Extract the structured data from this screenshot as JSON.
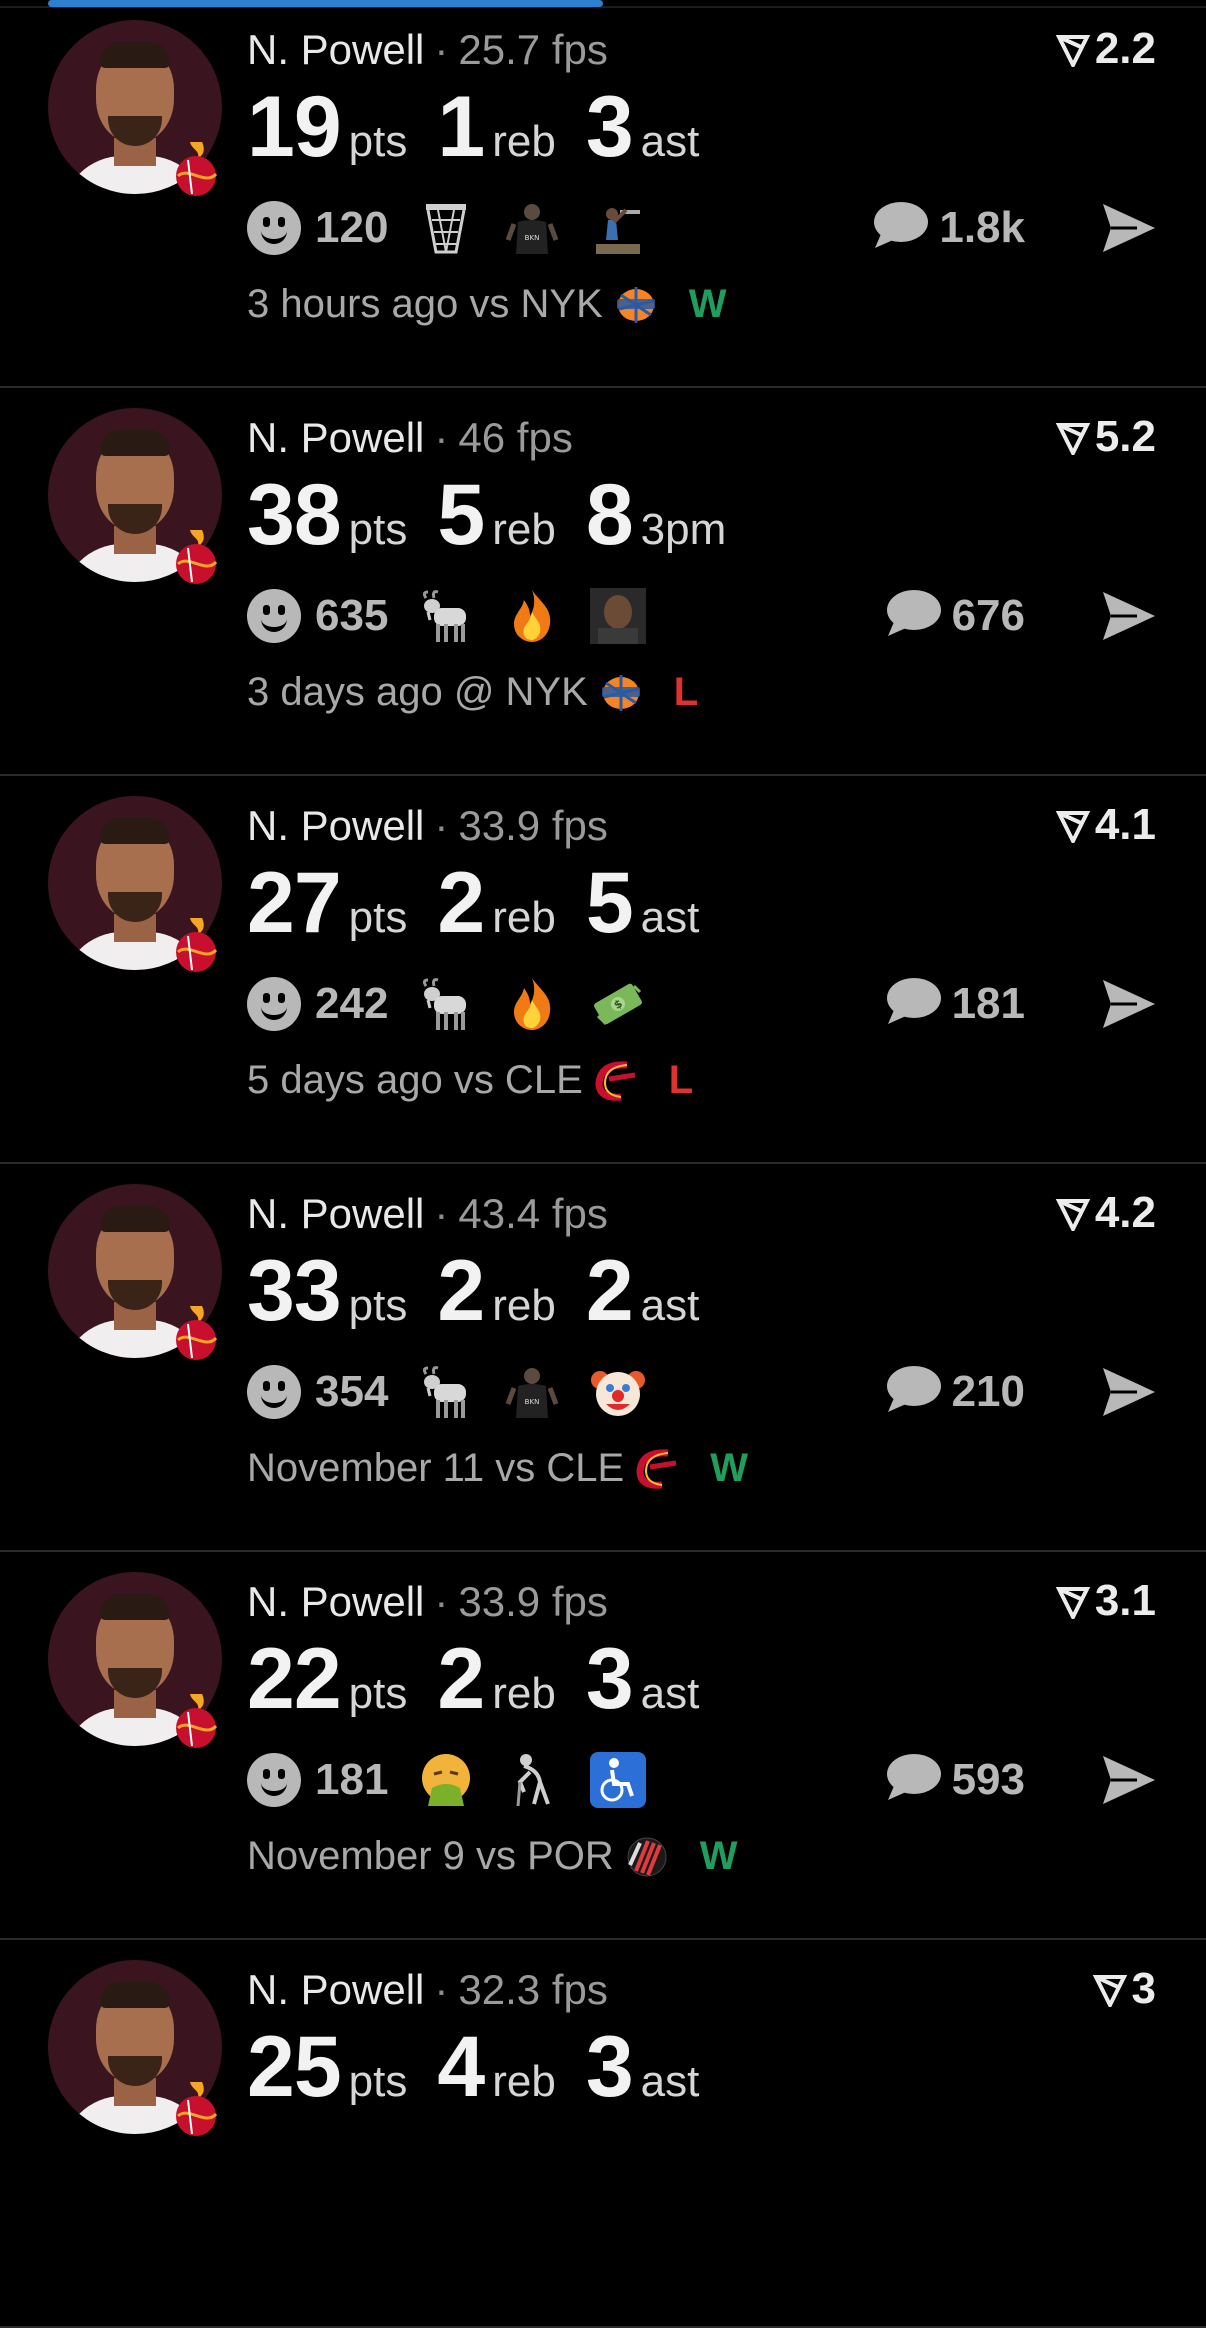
{
  "progress": {
    "fraction": 0.46
  },
  "colors": {
    "background": "#000000",
    "win": "#1f9e5c",
    "loss": "#e03131",
    "progress": "#2f7fd1",
    "avatar_bg": "#3a1520"
  },
  "cards": [
    {
      "player": "N. Powell",
      "fps": "25.7 fps",
      "rating": "2.2",
      "stats": [
        {
          "num": "19",
          "label": "pts"
        },
        {
          "num": "1",
          "label": "reb"
        },
        {
          "num": "3",
          "label": "ast"
        }
      ],
      "reactions_count": "120",
      "emojis": [
        "basketball-hoop",
        "nets-player",
        "dunk-player"
      ],
      "comments_count": "1.8k",
      "time": "3 hours ago vs NYK",
      "opponent": "knicks",
      "result": "W"
    },
    {
      "player": "N. Powell",
      "fps": "46 fps",
      "rating": "5.2",
      "stats": [
        {
          "num": "38",
          "label": "pts"
        },
        {
          "num": "5",
          "label": "reb"
        },
        {
          "num": "8",
          "label": "3pm"
        }
      ],
      "reactions_count": "635",
      "emojis": [
        "goat",
        "fire",
        "man-face"
      ],
      "comments_count": "676",
      "time": "3 days ago @ NYK",
      "opponent": "knicks",
      "result": "L"
    },
    {
      "player": "N. Powell",
      "fps": "33.9 fps",
      "rating": "4.1",
      "stats": [
        {
          "num": "27",
          "label": "pts"
        },
        {
          "num": "2",
          "label": "reb"
        },
        {
          "num": "5",
          "label": "ast"
        }
      ],
      "reactions_count": "242",
      "emojis": [
        "goat",
        "fire",
        "money"
      ],
      "comments_count": "181",
      "time": "5 days ago vs CLE",
      "opponent": "cavaliers",
      "result": "L"
    },
    {
      "player": "N. Powell",
      "fps": "43.4 fps",
      "rating": "4.2",
      "stats": [
        {
          "num": "33",
          "label": "pts"
        },
        {
          "num": "2",
          "label": "reb"
        },
        {
          "num": "2",
          "label": "ast"
        }
      ],
      "reactions_count": "354",
      "emojis": [
        "goat",
        "nets-player",
        "clown"
      ],
      "comments_count": "210",
      "time": "November 11 vs CLE",
      "opponent": "cavaliers",
      "result": "W"
    },
    {
      "player": "N. Powell",
      "fps": "33.9 fps",
      "rating": "3.1",
      "stats": [
        {
          "num": "22",
          "label": "pts"
        },
        {
          "num": "2",
          "label": "reb"
        },
        {
          "num": "3",
          "label": "ast"
        }
      ],
      "reactions_count": "181",
      "emojis": [
        "vomit",
        "old-man",
        "wheelchair"
      ],
      "comments_count": "593",
      "time": "November 9 vs POR",
      "opponent": "blazers",
      "result": "W"
    },
    {
      "player": "N. Powell",
      "fps": "32.3 fps",
      "rating": "3",
      "stats": [
        {
          "num": "25",
          "label": "pts"
        },
        {
          "num": "4",
          "label": "reb"
        },
        {
          "num": "3",
          "label": "ast"
        }
      ],
      "reactions_count": "",
      "emojis": [],
      "comments_count": "",
      "time": "",
      "opponent": "",
      "result": ""
    }
  ]
}
